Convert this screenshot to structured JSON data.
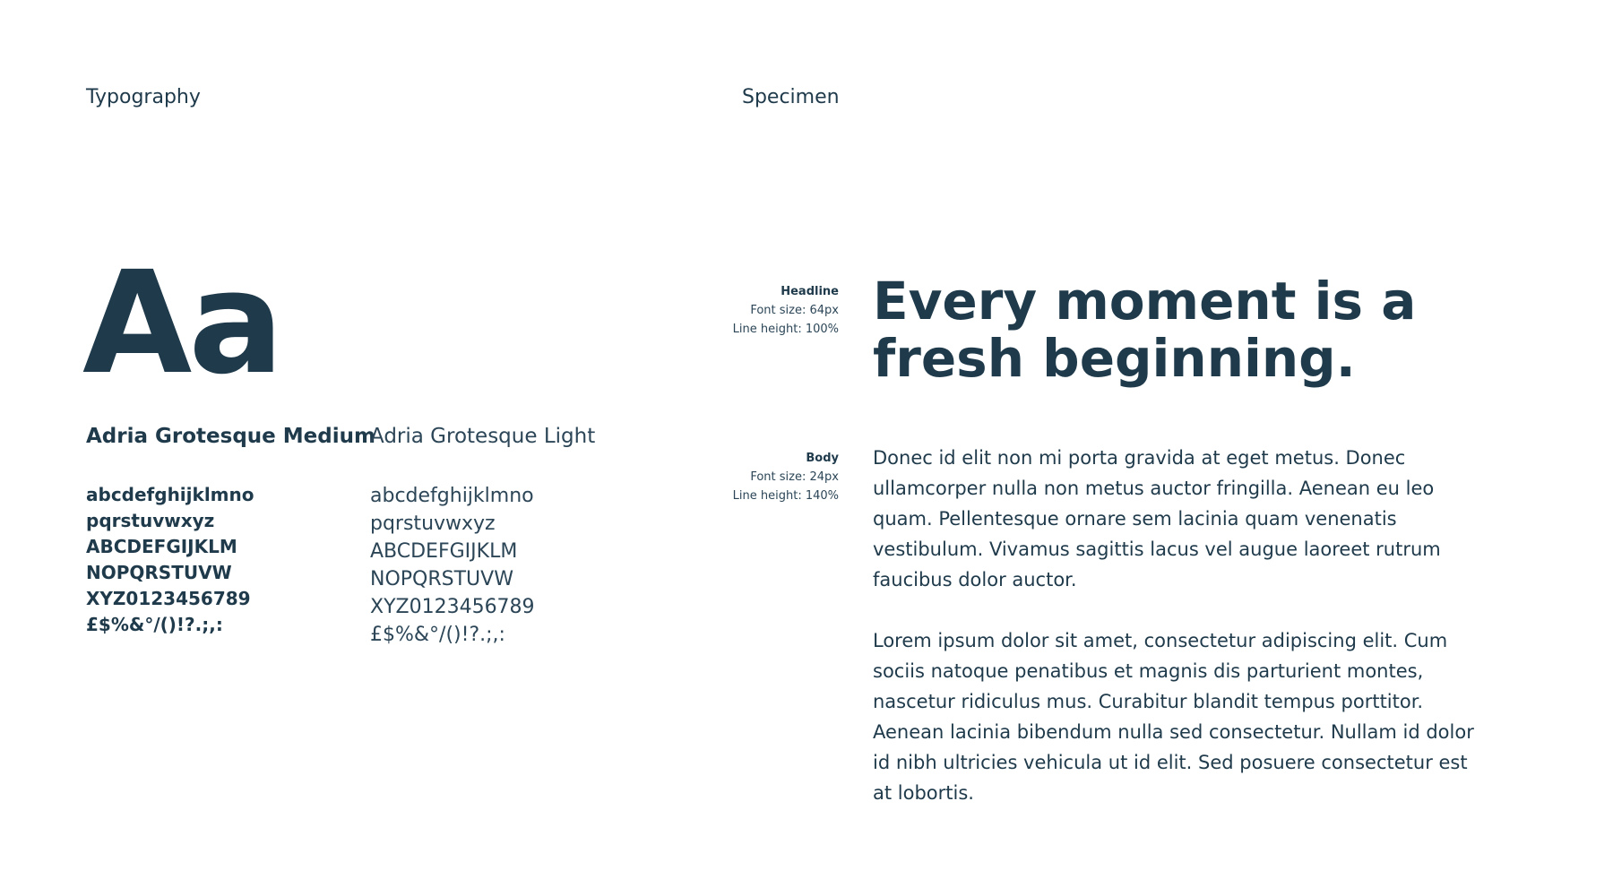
{
  "typography": {
    "title": "Typography",
    "sample": "Aa",
    "medium": {
      "name": "Adria Grotesque Medium",
      "lines": [
        "abcdefghijklmno",
        "pqrstuvwxyz",
        "ABCDEFGIJKLM",
        "NOPQRSTUVW",
        "XYZ0123456789",
        "£$%&°/()!?.;,:"
      ]
    },
    "light": {
      "name": "Adria Grotesque Light",
      "lines": [
        "abcdefghijklmno",
        "pqrstuvwxyz",
        "ABCDEFGIJKLM",
        "NOPQRSTUVW",
        "XYZ0123456789",
        "£$%&°/()!?.;,:"
      ]
    }
  },
  "specimen": {
    "title": "Specimen",
    "headline": {
      "label": "Headline",
      "font_size": "Font size: 64px",
      "line_height": "Line height: 100%",
      "text": "Every moment is a fresh beginning."
    },
    "body": {
      "label": "Body",
      "font_size": "Font size: 24px",
      "line_height": "Line height: 140%",
      "paragraphs": [
        "Donec id elit non mi porta gravida at eget metus. Donec ullamcorper nulla non metus auctor fringilla. Aenean eu leo quam. Pellentesque ornare sem lacinia quam venenatis vestibulum. Vivamus sagittis lacus vel augue laoreet rutrum faucibus dolor auctor.",
        "Lorem ipsum dolor sit amet, consectetur adipiscing elit. Cum sociis natoque penatibus et magnis dis parturient montes, nascetur ridiculus mus. Curabitur blandit tempus porttitor. Aenean lacinia bibendum nulla sed consectetur. Nullam id dolor id nibh ultricies vehicula ut id elit. Sed posuere consectetur est at lobortis."
      ]
    }
  },
  "colors": {
    "text": "#1f3a4b",
    "background": "#ffffff"
  }
}
